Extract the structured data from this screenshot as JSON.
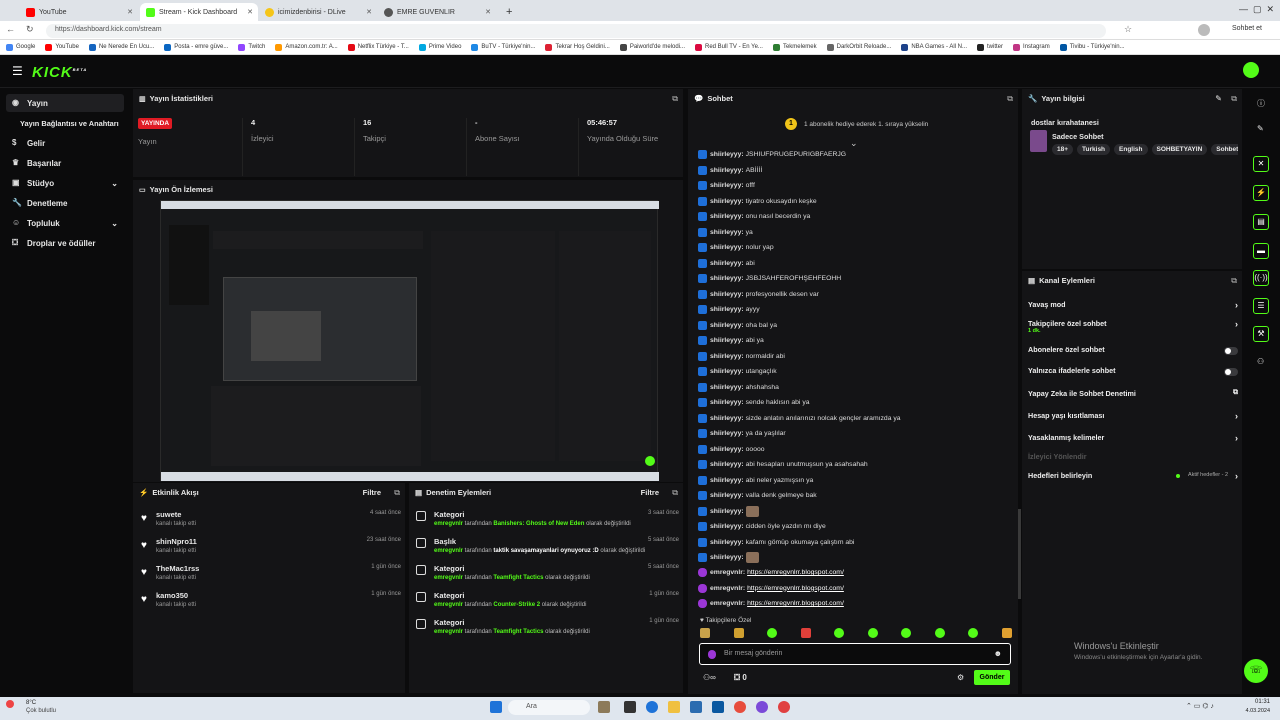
{
  "browser": {
    "tabs": [
      {
        "label": "YouTube",
        "color": "#ff0000"
      },
      {
        "label": "Stream - Kick Dashboard",
        "color": "#53fc18"
      },
      {
        "label": "icimizdenbirisi - DLive",
        "color": "#f5c518"
      },
      {
        "label": "EMRE GUVENLIR",
        "color": "#555"
      }
    ],
    "url": "https://dashboard.kick.com/stream",
    "chat_button": "Sohbet et",
    "bookmarks": [
      "Google",
      "YouTube",
      "Ne Nerede En Ucu...",
      "Posta - emre güve...",
      "Twitch",
      "Amazon.com.tr: A...",
      "Netflix Türkiye - T...",
      "Prime Video",
      "BuTV - Türkiye'nin...",
      "Tekrar Hoş Geldini...",
      "Paiworld'de melodi...",
      "Red Bull TV - En Ye...",
      "Tekmelemek",
      "DarkOrbit Reloade...",
      "NBA Games - All N...",
      "twitter",
      "Instagram",
      "Tivibu - Türkiye'nin..."
    ]
  },
  "app": {
    "logo": "KICK",
    "logo_sup": "BETA"
  },
  "sidebar": {
    "items": [
      {
        "label": "Yayın",
        "icon": "broadcast-icon"
      },
      {
        "label": "Yayın Bağlantısı ve Anahtarı",
        "icon": ""
      },
      {
        "label": "Gelir",
        "icon": "money-icon"
      },
      {
        "label": "Başarılar",
        "icon": "trophy-icon"
      },
      {
        "label": "Stüdyo",
        "icon": "studio-icon"
      },
      {
        "label": "Denetleme",
        "icon": "wrench-icon"
      },
      {
        "label": "Topluluk",
        "icon": "community-icon"
      },
      {
        "label": "Droplar ve ödüller",
        "icon": "gift-icon"
      }
    ]
  },
  "stats": {
    "title": "Yayın İstatistikleri",
    "live_badge": "YAYINDA",
    "items": [
      {
        "value": "",
        "label": "Yayın"
      },
      {
        "value": "4",
        "label": "İzleyici"
      },
      {
        "value": "16",
        "label": "Takipçi"
      },
      {
        "value": "-",
        "label": "Abone Sayısı"
      },
      {
        "value": "05:46:57",
        "label": "Yayında Olduğu Süre"
      }
    ]
  },
  "preview": {
    "title": "Yayın Ön İzlemesi"
  },
  "activity": {
    "title": "Etkinlik Akışı",
    "filter": "Filtre",
    "items": [
      {
        "name": "suwete",
        "sub": "kanalı takip etti",
        "time": "4 saat önce"
      },
      {
        "name": "shinNpro11",
        "sub": "kanalı takip etti",
        "time": "23 saat önce"
      },
      {
        "name": "TheMac1rss",
        "sub": "kanalı takip etti",
        "time": "1 gün önce"
      },
      {
        "name": "kamo350",
        "sub": "kanalı takip etti",
        "time": "1 gün önce"
      }
    ]
  },
  "moderation": {
    "title": "Denetim Eylemleri",
    "filter": "Filtre",
    "items": [
      {
        "name": "Kategori",
        "user": "emregvnlr",
        "mid": " tarafından ",
        "value": "Banishers: Ghosts of New Eden",
        "end": " olarak değiştirildi",
        "time": "3 saat önce"
      },
      {
        "name": "Başlık",
        "user": "emregvnlr",
        "mid": " tarafından ",
        "value": "taktik savaşamayanlari oynuyoruz :D",
        "end": " olarak değiştirildi",
        "time": "5 saat önce"
      },
      {
        "name": "Kategori",
        "user": "emregvnlr",
        "mid": " tarafından ",
        "value": "Teamfight Tactics",
        "end": " olarak değiştirildi",
        "time": "5 saat önce"
      },
      {
        "name": "Kategori",
        "user": "emregvnlr",
        "mid": " tarafından ",
        "value": "Counter-Strike 2",
        "end": " olarak değiştirildi",
        "time": "1 gün önce"
      },
      {
        "name": "Kategori",
        "user": "emregvnlr",
        "mid": " tarafından ",
        "value": "Teamfight Tactics",
        "end": " olarak değiştirildi",
        "time": "1 gün önce"
      }
    ]
  },
  "chat": {
    "title": "Sohbet",
    "pinned": "1 abonelik hediye ederek 1. sıraya yükselin",
    "messages": [
      {
        "user": "shiirleyyy:",
        "text": "JSHIUFPRUGEPURIGBFAERJG"
      },
      {
        "user": "shiirleyyy:",
        "text": "ABİİİİ"
      },
      {
        "user": "shiirleyyy:",
        "text": "offf"
      },
      {
        "user": "shiirleyyy:",
        "text": "tiyatro okusaydın keşke"
      },
      {
        "user": "shiirleyyy:",
        "text": "onu nasıl becerdin ya"
      },
      {
        "user": "shiirleyyy:",
        "text": "ya"
      },
      {
        "user": "shiirleyyy:",
        "text": "nolur yap"
      },
      {
        "user": "shiirleyyy:",
        "text": "abi"
      },
      {
        "user": "shiirleyyy:",
        "text": "JSBJSAHFEROFHŞEHFEOHH"
      },
      {
        "user": "shiirleyyy:",
        "text": "profesyonellik desen var"
      },
      {
        "user": "shiirleyyy:",
        "text": "ayyy"
      },
      {
        "user": "shiirleyyy:",
        "text": "oha bal ya"
      },
      {
        "user": "shiirleyyy:",
        "text": "abi ya"
      },
      {
        "user": "shiirleyyy:",
        "text": "normaldir abi"
      },
      {
        "user": "shiirleyyy:",
        "text": "utangaçlık"
      },
      {
        "user": "shiirleyyy:",
        "text": "ahshahsha"
      },
      {
        "user": "shiirleyyy:",
        "text": "sende haklısın abi ya"
      },
      {
        "user": "shiirleyyy:",
        "text": "sizde anlatın anılarınızı nolcak gençler aramızda ya"
      },
      {
        "user": "shiirleyyy:",
        "text": "ya da yaşlılar"
      },
      {
        "user": "shiirleyyy:",
        "text": "ooooo"
      },
      {
        "user": "shiirleyyy:",
        "text": "abi hesapları unutmuşsun ya asahsahah"
      },
      {
        "user": "shiirleyyy:",
        "text": "abi neler yazmışsın ya"
      },
      {
        "user": "shiirleyyy:",
        "text": "valla denk gelmeye bak"
      },
      {
        "user": "shiirleyyy:",
        "text": ""
      },
      {
        "user": "shiirleyyy:",
        "text": "cidden öyle yazdın mı diye"
      },
      {
        "user": "shiirleyyy:",
        "text": "kafamı gömüp okumaya çalıştım abi"
      },
      {
        "user": "shiirleyyy:",
        "text": ""
      }
    ],
    "links": [
      {
        "user": "emregvnlr:",
        "text": "https://emregvnlrr.blogspot.com/"
      },
      {
        "user": "emregvnlr:",
        "text": "https://emregvnlrr.blogspot.com/"
      },
      {
        "user": "emregvnlr:",
        "text": "https://emregvnlrr.blogspot.com/"
      }
    ],
    "follower_only": "Takipçilere Özel",
    "input_placeholder": "Bir mesaj gönderin",
    "send": "Gönder",
    "counter": "0"
  },
  "info": {
    "title": "Yayın bilgisi",
    "stream_title": "dostlar kırahatanesi",
    "category": "Sadece Sohbet",
    "tags": [
      "18+",
      "Turkish",
      "English",
      "SOHBETYAYIN",
      "Sohbet"
    ]
  },
  "channel_actions": {
    "title": "Kanal Eylemleri",
    "items": [
      {
        "label": "Yavaş mod",
        "kind": "arrow",
        "sub": ""
      },
      {
        "label": "Takipçilere özel sohbet",
        "kind": "arrow",
        "sub": "1 dk."
      },
      {
        "label": "Abonelere özel sohbet",
        "kind": "toggle",
        "sub": ""
      },
      {
        "label": "Yalnızca ifadelerle sohbet",
        "kind": "toggle",
        "sub": ""
      },
      {
        "label": "Yapay Zeka ile Sohbet Denetimi",
        "kind": "ext",
        "sub": ""
      },
      {
        "label": "Hesap yaşı kısıtlaması",
        "kind": "arrow",
        "sub": ""
      },
      {
        "label": "Yasaklanmış kelimeler",
        "kind": "arrow",
        "sub": ""
      },
      {
        "label": "İzleyici Yönlendir",
        "kind": "disabled",
        "sub": ""
      },
      {
        "label": "Hedefleri belirleyin",
        "kind": "arrow",
        "sub": "",
        "extra": "Aktif hedefler - 2"
      }
    ]
  },
  "watermark": {
    "line1": "Windows'u Etkinleştir",
    "line2": "Windows'u etkinleştirmek için Ayarlar'a gidin."
  },
  "taskbar": {
    "weather_temp": "8°C",
    "weather_desc": "Çok bulutlu",
    "search": "Ara",
    "time": "01:31",
    "date": "4.03.2024"
  },
  "colors": {
    "accent": "#53fc18",
    "live": "#e01b24",
    "bg": "#0b0b0c",
    "panel": "#141416"
  }
}
